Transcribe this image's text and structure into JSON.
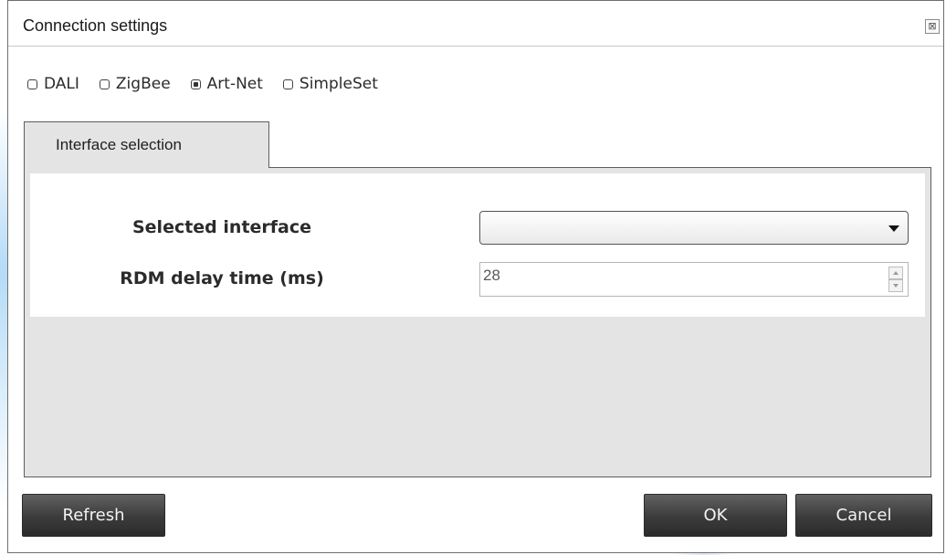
{
  "window": {
    "title": "Connection settings",
    "close_glyph": "⊠"
  },
  "protocols": [
    {
      "label": "DALI",
      "checked": false
    },
    {
      "label": "ZigBee",
      "checked": false
    },
    {
      "label": "Art-Net",
      "checked": true
    },
    {
      "label": "SimpleSet",
      "checked": false
    }
  ],
  "tabs": [
    {
      "label": "Interface selection",
      "active": true
    }
  ],
  "form": {
    "selected_interface_label": "Selected interface",
    "selected_interface_value": "",
    "rdm_delay_label": "RDM delay time (ms)",
    "rdm_delay_value": "28"
  },
  "footer": {
    "refresh_label": "Refresh",
    "ok_label": "OK",
    "cancel_label": "Cancel"
  },
  "icons": {
    "close": "close-icon",
    "dropdown": "chevron-down-icon",
    "spin_up": "spin-up-icon",
    "spin_down": "spin-down-icon"
  }
}
